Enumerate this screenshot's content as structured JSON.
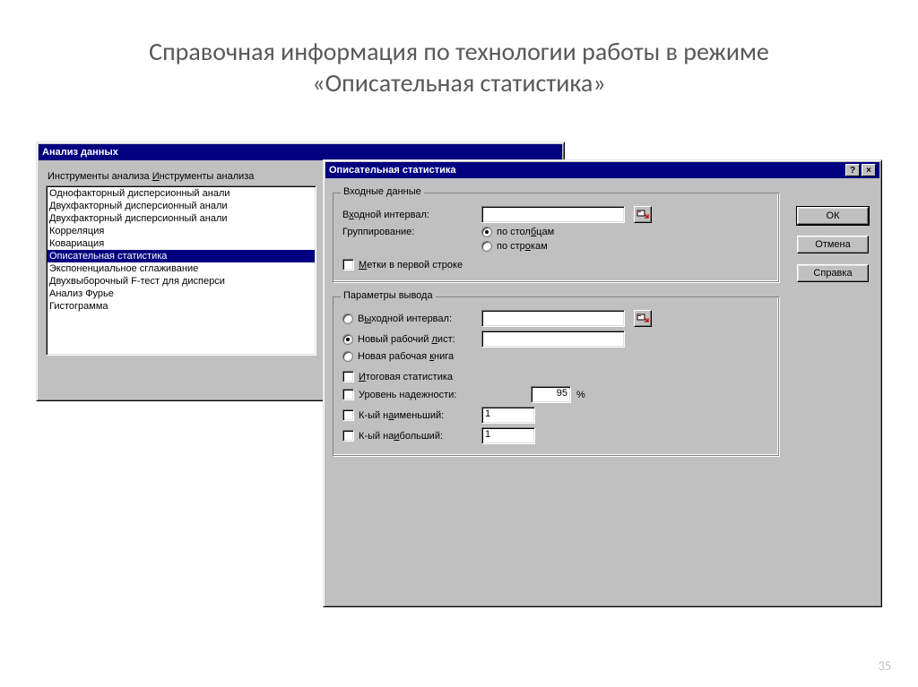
{
  "slide": {
    "title": "Справочная информация по технологии работы в режиме «Описательная статистика»",
    "page_number": "35"
  },
  "analysis_window": {
    "title": "Анализ данных",
    "tools_label": "Инструменты анализа",
    "selected_index": 5,
    "items": [
      "Однофакторный дисперсионный анали",
      "Двухфакторный дисперсионный анали",
      "Двухфакторный дисперсионный анали",
      "Корреляция",
      "Ковариация",
      "Описательная статистика",
      "Экспоненциальное сглаживание",
      "Двухвыборочный F-тест для дисперси",
      "Анализ Фурье",
      "Гистограмма"
    ]
  },
  "desc_window": {
    "title": "Описательная статистика",
    "buttons": {
      "ok": "ОК",
      "cancel": "Отмена",
      "help": "Справка"
    },
    "input_group": {
      "legend": "Входные данные",
      "range_prefix": "В",
      "range_u": "х",
      "range_suffix": "одной интервал:",
      "range_value": "",
      "grouping_label": "Группирование:",
      "by_cols_prefix": "по стол",
      "by_cols_u": "б",
      "by_cols_suffix": "цам",
      "by_rows_prefix": "по стр",
      "by_rows_u": "о",
      "by_rows_suffix": "кам",
      "grouping_selected": "columns",
      "labels_u": "М",
      "labels_suffix": "етки в первой строке",
      "labels_checked": false
    },
    "output_group": {
      "legend": "Параметры вывода",
      "out_range_prefix": "В",
      "out_range_u": "ы",
      "out_range_suffix": "ходной интервал:",
      "out_range_value": "",
      "new_sheet_prefix": "Новый рабочий ",
      "new_sheet_u": "л",
      "new_sheet_suffix": "ист:",
      "new_sheet_value": "",
      "new_book_prefix": "Новая рабочая ",
      "new_book_u": "к",
      "new_book_suffix": "нига",
      "output_selected": "new_sheet",
      "summary_u": "И",
      "summary_suffix": "тоговая статистика",
      "summary_checked": false,
      "conf_label": "Уровень надежности:",
      "conf_value": "95",
      "conf_pct": "%",
      "conf_checked": false,
      "kmin_prefix": "К-ый н",
      "kmin_u": "а",
      "kmin_suffix": "именьший:",
      "kmin_value": "1",
      "kmin_checked": false,
      "kmax_prefix": "К-ый на",
      "kmax_u": "и",
      "kmax_suffix": "больший:",
      "kmax_value": "1",
      "kmax_checked": false
    }
  }
}
